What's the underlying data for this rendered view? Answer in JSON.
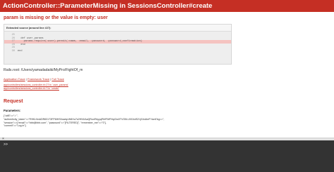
{
  "header": {
    "title": "ActionController::ParameterMissing in SessionsController#create"
  },
  "error": {
    "message": "param is missing or the value is empty: user"
  },
  "source": {
    "heading": "Extracted source (around line #27):",
    "lines": [
      {
        "num": "25",
        "code": "",
        "highlight": false
      },
      {
        "num": "26",
        "code": "  def user_params",
        "highlight": false
      },
      {
        "num": "27",
        "code": "    params.require(:user).permit(:name, :email, :password, :password_confirmation)",
        "highlight": true
      },
      {
        "num": "28",
        "code": "  end",
        "highlight": false
      },
      {
        "num": "29",
        "code": "",
        "highlight": false
      },
      {
        "num": "30",
        "code": "end",
        "highlight": false
      }
    ]
  },
  "rails_root": "Rails.root: /Users/yamadadaiki/MyPro/FightOf_m",
  "traces": {
    "application": "Application Trace",
    "framework": "Framework Trace",
    "full": "Full Trace",
    "separator": "|",
    "lines": [
      "app/controllers/sessions_controller.rb:27:in `user_params'",
      "app/controllers/sessions_controller.rb:7:in `create'"
    ]
  },
  "request": {
    "title": "Request",
    "params_label": "Parameters:",
    "params_lines": [
      "{\"utf8\"=>\"✓\",",
      " \"authenticity_token\"=>\"R9KLNnADR83173FP8IHS0owiqLW6Hu7s2HNXAaQRonRkyyqRWFMFNiyOw0TVG5LU0G4dS21jG4dAnFYsmEkg==\",",
      " \"session\"=>{\"email\"=>\"bbb@bbb.com\", \"password\"=>\"[FILTERED]\", \"remember_me\"=>\"0\"},",
      " \"commit\"=>\"Log in\"}"
    ]
  },
  "console": {
    "close_glyph": "×",
    "prompt": ">>"
  }
}
